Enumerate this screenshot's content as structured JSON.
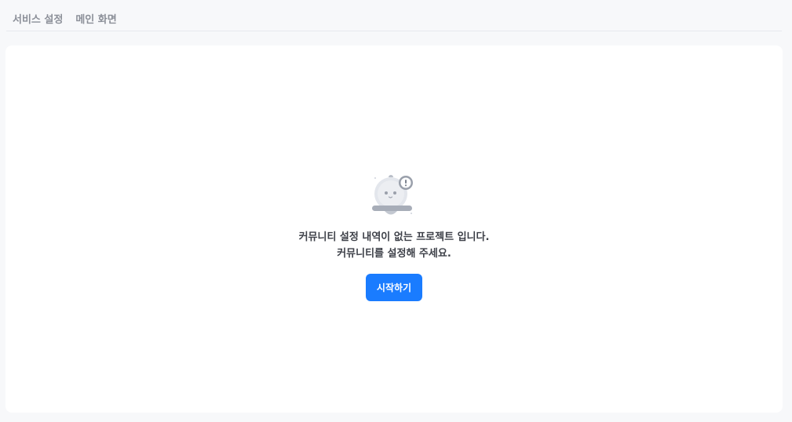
{
  "breadcrumb": {
    "items": [
      "서비스 설정",
      "메인 화면"
    ]
  },
  "empty_state": {
    "icon": "bell-alert-icon",
    "line1": "커뮤니티 설정 내역이 없는 프로젝트 입니다.",
    "line2": "커뮤니티를 설정해 주세요.",
    "button_label": "시작하기"
  },
  "colors": {
    "accent": "#1a7cff",
    "background": "#f7f8fa",
    "panel": "#ffffff"
  }
}
